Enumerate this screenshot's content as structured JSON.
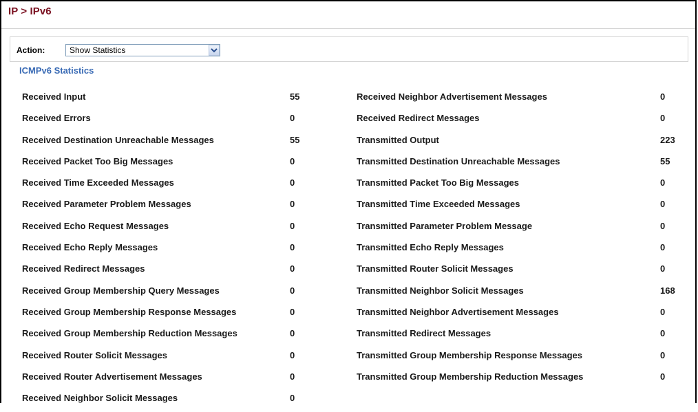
{
  "header": {
    "breadcrumb": "IP > IPv6"
  },
  "action": {
    "label": "Action:",
    "selected": "Show Statistics"
  },
  "section": {
    "title": "ICMPv6 Statistics"
  },
  "stats": {
    "left": [
      {
        "label": "Received Input",
        "value": "55"
      },
      {
        "label": "Received Errors",
        "value": "0"
      },
      {
        "label": "Received Destination Unreachable Messages",
        "value": "55"
      },
      {
        "label": "Received Packet Too Big Messages",
        "value": "0"
      },
      {
        "label": "Received Time Exceeded Messages",
        "value": "0"
      },
      {
        "label": "Received Parameter Problem Messages",
        "value": "0"
      },
      {
        "label": "Received Echo Request Messages",
        "value": "0"
      },
      {
        "label": "Received Echo Reply Messages",
        "value": "0"
      },
      {
        "label": "Received Redirect Messages",
        "value": "0"
      },
      {
        "label": "Received Group Membership Query Messages",
        "value": "0"
      },
      {
        "label": "Received Group Membership Response Messages",
        "value": "0"
      },
      {
        "label": "Received Group Membership Reduction Messages",
        "value": "0"
      },
      {
        "label": "Received Router Solicit Messages",
        "value": "0"
      },
      {
        "label": "Received Router Advertisement Messages",
        "value": "0"
      },
      {
        "label": "Received Neighbor Solicit Messages",
        "value": "0"
      }
    ],
    "right": [
      {
        "label": "Received Neighbor Advertisement Messages",
        "value": "0"
      },
      {
        "label": "Received Redirect Messages",
        "value": "0"
      },
      {
        "label": "Transmitted Output",
        "value": "223"
      },
      {
        "label": "Transmitted Destination Unreachable Messages",
        "value": "55"
      },
      {
        "label": "Transmitted Packet Too Big Messages",
        "value": "0"
      },
      {
        "label": "Transmitted Time Exceeded Messages",
        "value": "0"
      },
      {
        "label": "Transmitted Parameter Problem Message",
        "value": "0"
      },
      {
        "label": "Transmitted Echo Reply Messages",
        "value": "0"
      },
      {
        "label": "Transmitted Router Solicit Messages",
        "value": "0"
      },
      {
        "label": "Transmitted Neighbor Solicit Messages",
        "value": "168"
      },
      {
        "label": "Transmitted Neighbor Advertisement Messages",
        "value": "0"
      },
      {
        "label": "Transmitted Redirect Messages",
        "value": "0"
      },
      {
        "label": "Transmitted Group Membership Response Messages",
        "value": "0"
      },
      {
        "label": "Transmitted Group Membership Reduction Messages",
        "value": "0"
      }
    ]
  },
  "colors": {
    "breadcrumb": "#7a1020",
    "section_title": "#3a6bb5",
    "text": "#1a1a1a"
  },
  "icons": {
    "dropdown": "chevron-down-icon"
  }
}
